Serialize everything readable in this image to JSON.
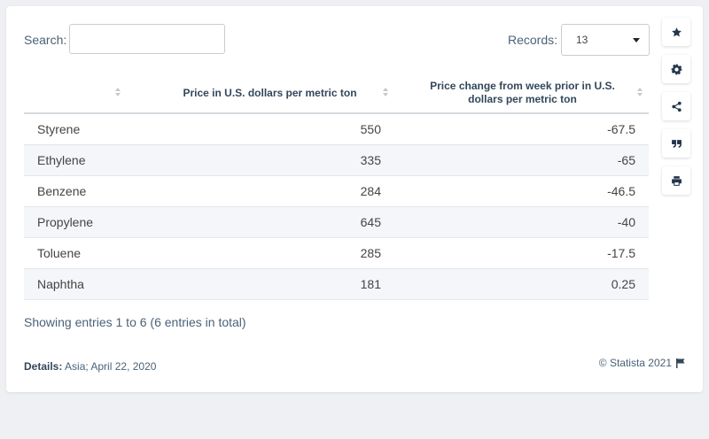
{
  "search": {
    "label": "Search:",
    "placeholder": "",
    "value": ""
  },
  "records": {
    "label": "Records:",
    "selected": "13"
  },
  "table": {
    "headers": [
      "",
      "Price in U.S. dollars per metric ton",
      "Price change from week prior in U.S. dollars per metric ton"
    ],
    "rows": [
      [
        "Styrene",
        "550",
        "-67.5"
      ],
      [
        "Ethylene",
        "335",
        "-65"
      ],
      [
        "Benzene",
        "284",
        "-46.5"
      ],
      [
        "Propylene",
        "645",
        "-40"
      ],
      [
        "Toluene",
        "285",
        "-17.5"
      ],
      [
        "Naphtha",
        "181",
        "0.25"
      ]
    ]
  },
  "footer": {
    "info": "Showing entries 1 to 6 (6 entries in total)",
    "details_label": "Details:",
    "details_text": "Asia; April 22, 2020",
    "copyright": "© Statista 2021"
  },
  "toolbar": {
    "icons": [
      "star-icon",
      "gear-icon",
      "share-icon",
      "quote-icon",
      "print-icon"
    ]
  },
  "colors": {
    "accent": "#23364b",
    "stripe": "#f4f6f9"
  }
}
